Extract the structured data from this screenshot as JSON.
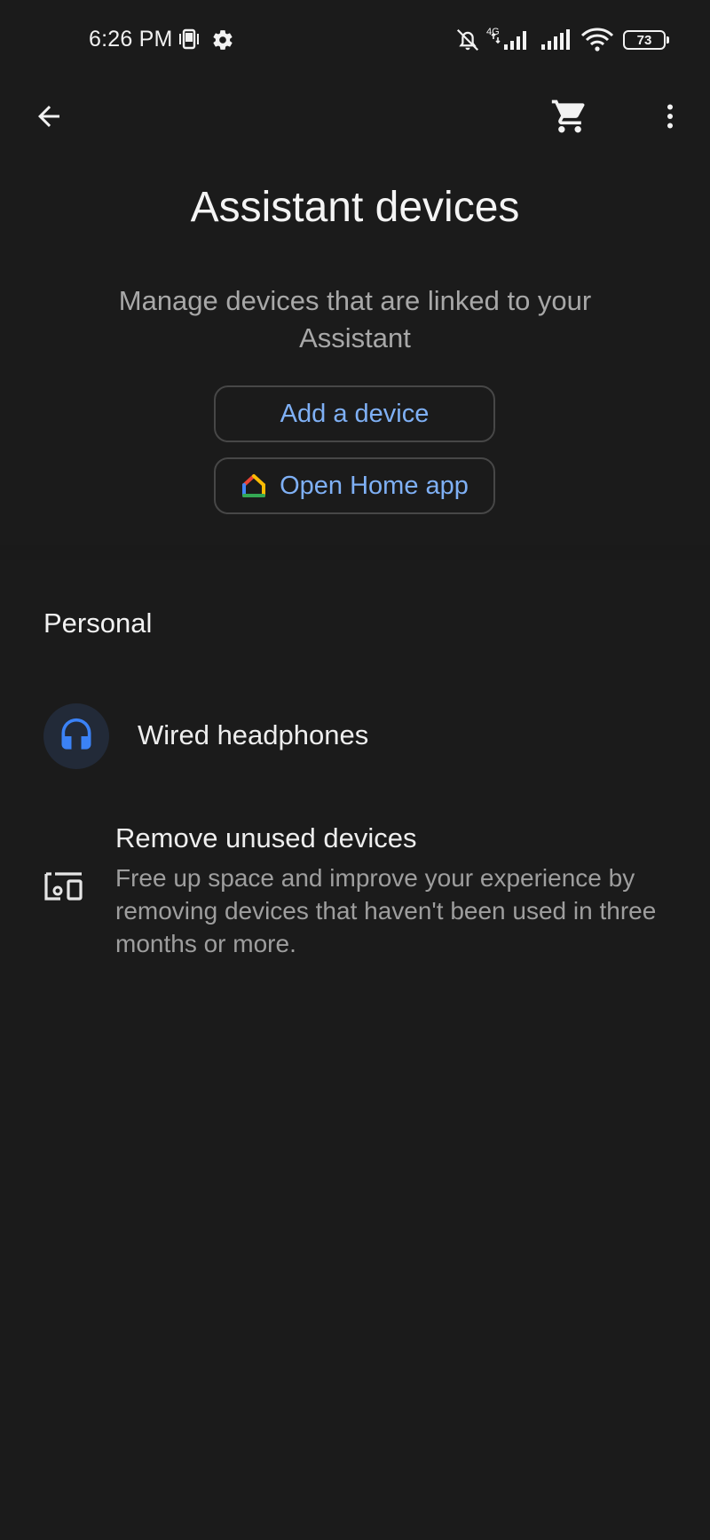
{
  "status_bar": {
    "time": "6:26 PM",
    "network_tag": "4G",
    "battery": "73",
    "icons": [
      "phone-vibrate-icon",
      "settings-gear-icon",
      "bell-off-icon",
      "signal-4g-icon",
      "signal-icon",
      "wifi-icon",
      "battery-icon"
    ]
  },
  "app_bar": {
    "icons": [
      "back-arrow-icon",
      "shopping-cart-icon",
      "more-vert-icon"
    ]
  },
  "header": {
    "title": "Assistant devices",
    "subtitle": "Manage devices that are linked to your Assistant"
  },
  "actions": {
    "add_device_label": "Add a device",
    "open_home_label": "Open Home app"
  },
  "personal": {
    "heading": "Personal",
    "devices": [
      {
        "label": "Wired headphones",
        "icon": "headphones-icon"
      }
    ]
  },
  "remove_unused": {
    "title": "Remove unused devices",
    "description": "Free up space and improve your experience by removing devices that haven't been used in three months or more.",
    "icon": "devices-icon"
  },
  "colors": {
    "background": "#1b1b1b",
    "accent_text": "#7fb0f5",
    "headphones_blue": "#3b82f6",
    "secondary_text": "#a8a8a8"
  }
}
